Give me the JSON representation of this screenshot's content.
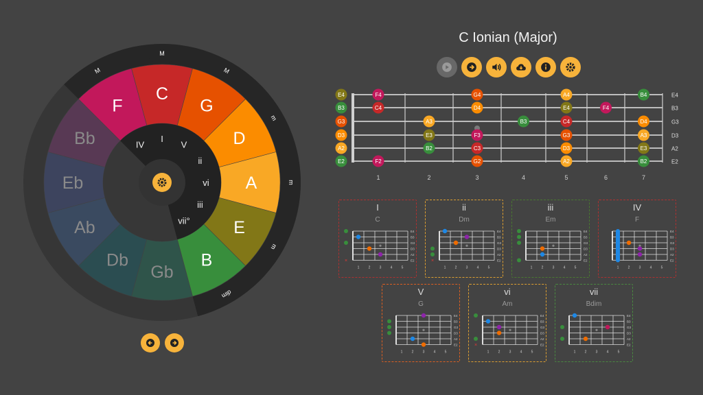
{
  "mode_title": "C Ionian (Major)",
  "wheel": {
    "keys": [
      {
        "name": "C",
        "color": "#c62828",
        "quality": "M",
        "active": true
      },
      {
        "name": "G",
        "color": "#e65100",
        "quality": "M",
        "active": true
      },
      {
        "name": "D",
        "color": "#fb8c00",
        "quality": "m",
        "active": true
      },
      {
        "name": "A",
        "color": "#f9a825",
        "quality": "m",
        "active": true
      },
      {
        "name": "E",
        "color": "#827717",
        "quality": "m",
        "active": true
      },
      {
        "name": "B",
        "color": "#388e3c",
        "quality": "dim",
        "active": true
      },
      {
        "name": "Gb",
        "color": "#2e5a4e",
        "quality": "",
        "active": false
      },
      {
        "name": "Db",
        "color": "#2a5256",
        "quality": "",
        "active": false
      },
      {
        "name": "Ab",
        "color": "#3b4e68",
        "quality": "",
        "active": false
      },
      {
        "name": "Eb",
        "color": "#3f4766",
        "quality": "",
        "active": false
      },
      {
        "name": "Bb",
        "color": "#5e3a5a",
        "quality": "",
        "active": false
      },
      {
        "name": "F",
        "color": "#c2185b",
        "quality": "M",
        "active": true
      }
    ],
    "degrees": [
      "I",
      "V",
      "ii",
      "vi",
      "iii",
      "vii°",
      "",
      "",
      "",
      "",
      "",
      "IV"
    ]
  },
  "toolbar": [
    {
      "name": "play-button",
      "icon": "play-icon",
      "enabled": false
    },
    {
      "name": "next-button",
      "icon": "arrow-right-icon",
      "enabled": true
    },
    {
      "name": "sound-button",
      "icon": "volume-icon",
      "enabled": true
    },
    {
      "name": "download-button",
      "icon": "cloud-download-icon",
      "enabled": true
    },
    {
      "name": "info-button",
      "icon": "info-icon",
      "enabled": true
    },
    {
      "name": "settings-button",
      "icon": "gear-icon",
      "enabled": true
    }
  ],
  "fretboard": {
    "strings": [
      "E4",
      "B3",
      "G3",
      "D3",
      "A2",
      "E2"
    ],
    "open_colors": [
      "#827717",
      "#388e3c",
      "#e65100",
      "#fb8c00",
      "#f9a825",
      "#388e3c"
    ],
    "fret_numbers": [
      "1",
      "2",
      "3",
      "4",
      "5",
      "6",
      "7"
    ],
    "notes": [
      {
        "s": 0,
        "f": 1,
        "label": "F4",
        "color": "#c2185b"
      },
      {
        "s": 0,
        "f": 3,
        "label": "G4",
        "color": "#e65100"
      },
      {
        "s": 0,
        "f": 5,
        "label": "A4",
        "color": "#f9a825"
      },
      {
        "s": 0,
        "f": 7,
        "label": "B4",
        "color": "#388e3c"
      },
      {
        "s": 1,
        "f": 1,
        "label": "C4",
        "color": "#c62828"
      },
      {
        "s": 1,
        "f": 3,
        "label": "D4",
        "color": "#fb8c00"
      },
      {
        "s": 1,
        "f": 5,
        "label": "E4",
        "color": "#827717"
      },
      {
        "s": 1,
        "f": 6,
        "label": "F4",
        "color": "#c2185b"
      },
      {
        "s": 2,
        "f": 2,
        "label": "A3",
        "color": "#f9a825"
      },
      {
        "s": 2,
        "f": 4,
        "label": "B3",
        "color": "#388e3c"
      },
      {
        "s": 2,
        "f": 5,
        "label": "C4",
        "color": "#c62828"
      },
      {
        "s": 2,
        "f": 7,
        "label": "D4",
        "color": "#fb8c00"
      },
      {
        "s": 3,
        "f": 2,
        "label": "E3",
        "color": "#827717"
      },
      {
        "s": 3,
        "f": 3,
        "label": "F3",
        "color": "#c2185b"
      },
      {
        "s": 3,
        "f": 5,
        "label": "G3",
        "color": "#e65100"
      },
      {
        "s": 3,
        "f": 7,
        "label": "A3",
        "color": "#f9a825"
      },
      {
        "s": 4,
        "f": 2,
        "label": "B2",
        "color": "#388e3c"
      },
      {
        "s": 4,
        "f": 3,
        "label": "C3",
        "color": "#c62828"
      },
      {
        "s": 4,
        "f": 5,
        "label": "D3",
        "color": "#fb8c00"
      },
      {
        "s": 4,
        "f": 7,
        "label": "E3",
        "color": "#827717"
      },
      {
        "s": 5,
        "f": 1,
        "label": "F2",
        "color": "#c2185b"
      },
      {
        "s": 5,
        "f": 3,
        "label": "G2",
        "color": "#e65100"
      },
      {
        "s": 5,
        "f": 5,
        "label": "A2",
        "color": "#f9a825"
      },
      {
        "s": 5,
        "f": 7,
        "label": "B2",
        "color": "#388e3c"
      }
    ]
  },
  "chord_strings": [
    "E4",
    "B3",
    "G3",
    "D3",
    "A2",
    "E2"
  ],
  "chord_fret_numbers": [
    "1",
    "2",
    "3",
    "4",
    "5"
  ],
  "chords": [
    {
      "numeral": "I",
      "name": "C",
      "border": "#b03030",
      "open": [
        1,
        0,
        1,
        0,
        0,
        2
      ],
      "dots": [
        {
          "s": 1,
          "f": 1,
          "c": "#1e88e5"
        },
        {
          "s": 3,
          "f": 2,
          "c": "#ef6c00"
        },
        {
          "s": 4,
          "f": 3,
          "c": "#8e24aa"
        }
      ],
      "barre": null
    },
    {
      "numeral": "ii",
      "name": "Dm",
      "border": "#e0a030",
      "open": [
        0,
        0,
        0,
        1,
        1,
        2
      ],
      "dots": [
        {
          "s": 0,
          "f": 1,
          "c": "#1e88e5"
        },
        {
          "s": 2,
          "f": 2,
          "c": "#ef6c00"
        },
        {
          "s": 1,
          "f": 3,
          "c": "#8e24aa"
        }
      ],
      "barre": null
    },
    {
      "numeral": "iii",
      "name": "Em",
      "border": "#4a7a30",
      "open": [
        1,
        1,
        1,
        0,
        0,
        1
      ],
      "dots": [
        {
          "s": 3,
          "f": 2,
          "c": "#ef6c00"
        },
        {
          "s": 4,
          "f": 2,
          "c": "#1e88e5"
        }
      ],
      "barre": null
    },
    {
      "numeral": "IV",
      "name": "F",
      "border": "#b03030",
      "open": [
        0,
        0,
        0,
        0,
        0,
        0
      ],
      "dots": [
        {
          "s": 3,
          "f": 3,
          "c": "#8e24aa"
        },
        {
          "s": 4,
          "f": 3,
          "c": "#8e24aa"
        },
        {
          "s": 2,
          "f": 2,
          "c": "#ef6c00"
        }
      ],
      "barre": {
        "f": 1,
        "c": "#1e88e5"
      }
    },
    {
      "numeral": "V",
      "name": "G",
      "border": "#e06020",
      "open": [
        0,
        1,
        1,
        1,
        0,
        0
      ],
      "dots": [
        {
          "s": 0,
          "f": 3,
          "c": "#8e24aa"
        },
        {
          "s": 4,
          "f": 2,
          "c": "#1e88e5"
        },
        {
          "s": 5,
          "f": 3,
          "c": "#ef6c00"
        }
      ],
      "barre": null
    },
    {
      "numeral": "vi",
      "name": "Am",
      "border": "#e0a030",
      "open": [
        1,
        0,
        0,
        0,
        1,
        2
      ],
      "dots": [
        {
          "s": 1,
          "f": 1,
          "c": "#1e88e5"
        },
        {
          "s": 2,
          "f": 2,
          "c": "#8e24aa"
        },
        {
          "s": 3,
          "f": 2,
          "c": "#ef6c00"
        }
      ],
      "barre": null
    },
    {
      "numeral": "vii",
      "name": "Bdim",
      "border": "#4a8a40",
      "open": [
        0,
        0,
        1,
        0,
        1,
        0
      ],
      "dots": [
        {
          "s": 0,
          "f": 1,
          "c": "#1e88e5"
        },
        {
          "s": 2,
          "f": 4,
          "c": "#c2185b"
        },
        {
          "s": 4,
          "f": 2,
          "c": "#ef6c00"
        }
      ],
      "barre": null
    }
  ],
  "nav": {
    "prev": "arrow-left-icon",
    "next": "arrow-right-icon"
  }
}
